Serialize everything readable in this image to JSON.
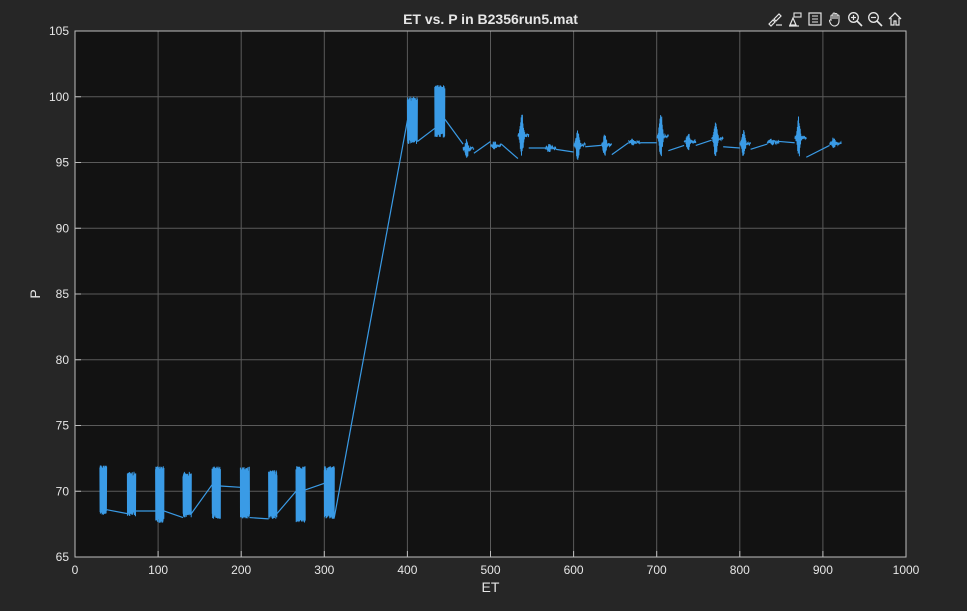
{
  "toolbar": {
    "icons": [
      "brush-icon",
      "data-tips-icon",
      "legend-icon",
      "pan-icon",
      "zoom-in-icon",
      "zoom-out-icon",
      "home-icon"
    ]
  },
  "colors": {
    "figure_bg": "#262626",
    "axes_bg": "#121212",
    "grid": "#5a5a5a",
    "axis_text": "#e6e6e6",
    "series": "#3a9be6"
  },
  "chart_data": {
    "type": "line",
    "title": "ET vs. P in B2356run5.mat",
    "xlabel": "ET",
    "ylabel": "P",
    "xlim": [
      0,
      1000
    ],
    "ylim": [
      65,
      105
    ],
    "xticks": [
      0,
      100,
      200,
      300,
      400,
      500,
      600,
      700,
      800,
      900,
      1000
    ],
    "yticks": [
      65,
      70,
      75,
      80,
      85,
      90,
      95,
      100,
      105
    ],
    "grid": true,
    "series": [
      {
        "color": "#3a9be6",
        "bursts": [
          {
            "x_start": 30,
            "x_end": 38,
            "y_min": 68.2,
            "y_max": 72.0,
            "pattern": "dense"
          },
          {
            "x_start": 63,
            "x_end": 73,
            "y_min": 68.1,
            "y_max": 71.5,
            "pattern": "dense"
          },
          {
            "x_start": 97,
            "x_end": 107,
            "y_min": 67.6,
            "y_max": 71.9,
            "pattern": "dense"
          },
          {
            "x_start": 130,
            "x_end": 140,
            "y_min": 68.0,
            "y_max": 71.5,
            "pattern": "dense"
          },
          {
            "x_start": 165,
            "x_end": 175,
            "y_min": 67.9,
            "y_max": 71.9,
            "pattern": "dense"
          },
          {
            "x_start": 199,
            "x_end": 210,
            "y_min": 67.9,
            "y_max": 71.9,
            "pattern": "dense"
          },
          {
            "x_start": 233,
            "x_end": 243,
            "y_min": 67.9,
            "y_max": 71.6,
            "pattern": "dense"
          },
          {
            "x_start": 266,
            "x_end": 277,
            "y_min": 67.6,
            "y_max": 71.9,
            "pattern": "dense"
          },
          {
            "x_start": 300,
            "x_end": 312,
            "y_min": 67.9,
            "y_max": 71.9,
            "pattern": "dense"
          },
          {
            "x_start": 400,
            "x_end": 412,
            "y_min": 96.4,
            "y_max": 100.0,
            "pattern": "dense"
          },
          {
            "x_start": 433,
            "x_end": 445,
            "y_min": 96.9,
            "y_max": 100.9,
            "pattern": "dense"
          },
          {
            "x_start": 467,
            "x_end": 480,
            "y_min": 95.3,
            "y_max": 96.8,
            "pattern": "spiky"
          },
          {
            "x_start": 500,
            "x_end": 513,
            "y_min": 96.0,
            "y_max": 96.6,
            "pattern": "spiky"
          },
          {
            "x_start": 533,
            "x_end": 546,
            "y_min": 95.2,
            "y_max": 98.9,
            "pattern": "spiky"
          },
          {
            "x_start": 566,
            "x_end": 579,
            "y_min": 95.8,
            "y_max": 96.4,
            "pattern": "spiky"
          },
          {
            "x_start": 600,
            "x_end": 614,
            "y_min": 95.2,
            "y_max": 97.5,
            "pattern": "spiky"
          },
          {
            "x_start": 633,
            "x_end": 646,
            "y_min": 95.4,
            "y_max": 97.3,
            "pattern": "spiky"
          },
          {
            "x_start": 666,
            "x_end": 680,
            "y_min": 96.3,
            "y_max": 96.8,
            "pattern": "spiky"
          },
          {
            "x_start": 700,
            "x_end": 714,
            "y_min": 95.1,
            "y_max": 98.9,
            "pattern": "spiky"
          },
          {
            "x_start": 733,
            "x_end": 747,
            "y_min": 95.9,
            "y_max": 97.3,
            "pattern": "spiky"
          },
          {
            "x_start": 766,
            "x_end": 780,
            "y_min": 95.3,
            "y_max": 98.3,
            "pattern": "spiky"
          },
          {
            "x_start": 800,
            "x_end": 813,
            "y_min": 95.3,
            "y_max": 97.6,
            "pattern": "spiky"
          },
          {
            "x_start": 833,
            "x_end": 847,
            "y_min": 96.3,
            "y_max": 96.8,
            "pattern": "spiky"
          },
          {
            "x_start": 866,
            "x_end": 880,
            "y_min": 95.3,
            "y_max": 98.5,
            "pattern": "spiky"
          },
          {
            "x_start": 908,
            "x_end": 922,
            "y_min": 96.0,
            "y_max": 96.9,
            "pattern": "spiky"
          }
        ],
        "connectors": [
          [
            [
              38,
              68.6
            ],
            [
              63,
              68.3
            ]
          ],
          [
            [
              73,
              68.5
            ],
            [
              97,
              68.5
            ]
          ],
          [
            [
              107,
              68.5
            ],
            [
              130,
              68.0
            ]
          ],
          [
            [
              140,
              68.3
            ],
            [
              165,
              70.5
            ]
          ],
          [
            [
              175,
              70.4
            ],
            [
              199,
              70.3
            ]
          ],
          [
            [
              210,
              68.0
            ],
            [
              233,
              67.9
            ]
          ],
          [
            [
              243,
              68.3
            ],
            [
              266,
              70.0
            ]
          ],
          [
            [
              277,
              70.1
            ],
            [
              300,
              70.6
            ]
          ],
          [
            [
              312,
              68.0
            ],
            [
              400,
              98.2
            ]
          ],
          [
            [
              412,
              96.6
            ],
            [
              433,
              97.6
            ]
          ],
          [
            [
              445,
              98.3
            ],
            [
              467,
              96.4
            ]
          ],
          [
            [
              480,
              95.7
            ],
            [
              500,
              96.6
            ]
          ],
          [
            [
              513,
              96.4
            ],
            [
              533,
              95.3
            ]
          ],
          [
            [
              546,
              96.1
            ],
            [
              566,
              96.1
            ]
          ],
          [
            [
              579,
              96.0
            ],
            [
              600,
              95.8
            ]
          ],
          [
            [
              614,
              96.2
            ],
            [
              633,
              96.3
            ]
          ],
          [
            [
              646,
              95.6
            ],
            [
              666,
              96.5
            ]
          ],
          [
            [
              680,
              96.5
            ],
            [
              700,
              96.5
            ]
          ],
          [
            [
              714,
              95.9
            ],
            [
              733,
              96.3
            ]
          ],
          [
            [
              747,
              96.3
            ],
            [
              766,
              96.7
            ]
          ],
          [
            [
              780,
              96.2
            ],
            [
              800,
              96.1
            ]
          ],
          [
            [
              813,
              96.0
            ],
            [
              833,
              96.4
            ]
          ],
          [
            [
              847,
              96.6
            ],
            [
              866,
              96.5
            ]
          ],
          [
            [
              880,
              95.4
            ],
            [
              908,
              96.3
            ]
          ]
        ]
      }
    ]
  }
}
